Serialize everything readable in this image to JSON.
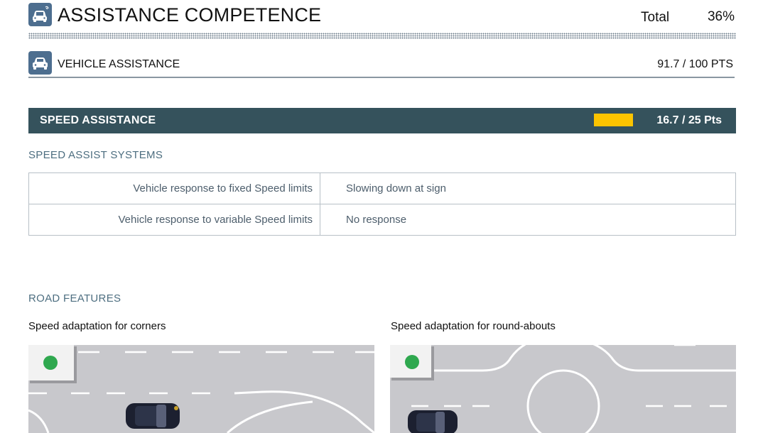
{
  "header": {
    "title": "ASSISTANCE COMPETENCE",
    "total_label": "Total",
    "total_value": "36%",
    "icon": "car-assist-icon"
  },
  "vehicle_assistance": {
    "label": "VEHICLE ASSISTANCE",
    "score": "91.7 / 100 PTS",
    "icon": "car-front-icon"
  },
  "speed_assistance": {
    "label": "SPEED ASSISTANCE",
    "score": "16.7 / 25 Pts",
    "gauge_fraction": 1.0,
    "gauge_color": "#fcc400",
    "bar_color": "#35525c"
  },
  "speed_assist_systems": {
    "heading": "SPEED ASSIST SYSTEMS",
    "rows": [
      {
        "label": "Vehicle response to fixed Speed limits",
        "value": "Slowing down at sign"
      },
      {
        "label": "Vehicle response to variable Speed limits",
        "value": "No response"
      }
    ]
  },
  "road_features": {
    "heading": "ROAD FEATURES",
    "items": [
      {
        "caption": "Speed adaptation for corners",
        "status_color": "#2fa84f"
      },
      {
        "caption": "Speed adaptation for round-abouts",
        "status_color": "#2fa84f"
      }
    ]
  },
  "colors": {
    "icon_bg": "#4d6e8f",
    "heading_text": "#4d6e80",
    "road": "#c8c8cc"
  }
}
